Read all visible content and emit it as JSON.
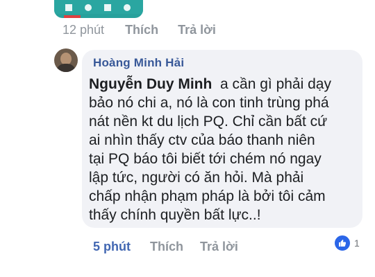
{
  "previous_comment": {
    "time": "12 phút",
    "like_label": "Thích",
    "reply_label": "Trả lời"
  },
  "comment": {
    "author": "Hoàng Minh Hải",
    "mention": "Nguyễn Duy Minh",
    "body_lines": [
      "a cần gì phải dạy",
      "bảo nó chi a, nó là con tinh trùng phá",
      "nát nền kt du lịch PQ. Chỉ cần bất cứ",
      "ai nhìn thấy ctv của báo thanh niên",
      "tại PQ báo tôi biết tới chém nó ngay",
      "lập tức, người có ăn hỏi. Mà phải",
      "chấp nhận phạm pháp là bởi tôi cảm",
      "thấy chính quyền bất lực..!"
    ],
    "time": "5 phút",
    "like_label": "Thích",
    "reply_label": "Trả lời",
    "reaction_count": "1"
  },
  "colors": {
    "bubble": "#f1f2f6",
    "author": "#385898",
    "action_gray": "#8f959c",
    "time_blue": "#4267b2",
    "like_blue": "#2b66e8"
  },
  "icons": {
    "reaction": "thumbs-up-icon",
    "avatar": "avatar"
  }
}
